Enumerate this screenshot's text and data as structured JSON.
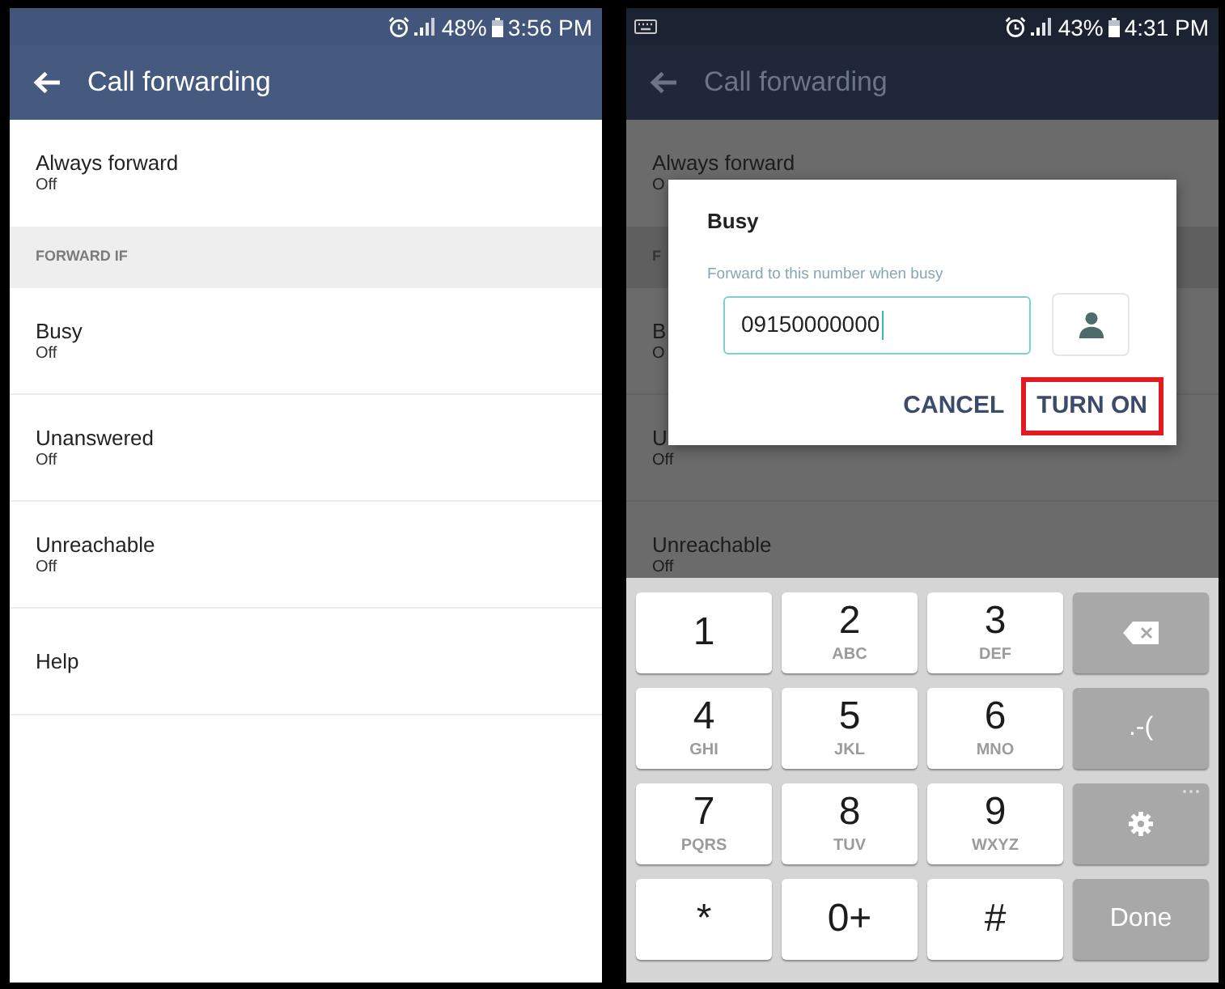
{
  "screens": [
    {
      "dimmed": false,
      "status_bar": {
        "keyboard_notification": false,
        "battery": "48%",
        "time": "3:56 PM"
      },
      "app_bar": {
        "title": "Call forwarding"
      },
      "list": [
        {
          "kind": "item",
          "title": "Always forward",
          "subtitle": "Off"
        },
        {
          "kind": "header",
          "title": "FORWARD IF"
        },
        {
          "kind": "item",
          "title": "Busy",
          "subtitle": "Off"
        },
        {
          "kind": "item",
          "title": "Unanswered",
          "subtitle": "Off"
        },
        {
          "kind": "item",
          "title": "Unreachable",
          "subtitle": "Off"
        },
        {
          "kind": "item",
          "title": "Help"
        }
      ]
    },
    {
      "dimmed": true,
      "status_bar": {
        "keyboard_notification": true,
        "battery": "43%",
        "time": "4:31 PM"
      },
      "app_bar": {
        "title": "Call forwarding"
      },
      "list": [
        {
          "kind": "item",
          "title": "Always forward",
          "subtitle": "O"
        },
        {
          "kind": "header",
          "title": "F"
        },
        {
          "kind": "item",
          "title": "B",
          "subtitle": "O"
        },
        {
          "kind": "item",
          "title": "U",
          "subtitle": "Off"
        },
        {
          "kind": "item",
          "title": "Unreachable",
          "subtitle": "Off"
        }
      ],
      "dialog": {
        "title": "Busy",
        "field_label": "Forward to this number when busy",
        "field_value": "09150000000",
        "focused": true,
        "buttons": [
          {
            "label": "CANCEL",
            "highlighted": false
          },
          {
            "label": "TURN ON",
            "highlighted": true
          }
        ]
      },
      "keypad": {
        "keys": [
          {
            "kind": "digit",
            "label": "1"
          },
          {
            "kind": "digit",
            "label": "2",
            "letters": "ABC"
          },
          {
            "kind": "digit",
            "label": "3",
            "letters": "DEF"
          },
          {
            "kind": "backspace"
          },
          {
            "kind": "digit",
            "label": "4",
            "letters": "GHI"
          },
          {
            "kind": "digit",
            "label": "5",
            "letters": "JKL"
          },
          {
            "kind": "digit",
            "label": "6",
            "letters": "MNO"
          },
          {
            "kind": "symbols",
            "label": ".-("
          },
          {
            "kind": "digit",
            "label": "7",
            "letters": "PQRS"
          },
          {
            "kind": "digit",
            "label": "8",
            "letters": "TUV"
          },
          {
            "kind": "digit",
            "label": "9",
            "letters": "WXYZ"
          },
          {
            "kind": "settings"
          },
          {
            "kind": "digit",
            "label": "*"
          },
          {
            "kind": "digit",
            "label": "0+"
          },
          {
            "kind": "digit",
            "label": "#"
          },
          {
            "kind": "done",
            "label": "Done"
          }
        ]
      }
    }
  ]
}
